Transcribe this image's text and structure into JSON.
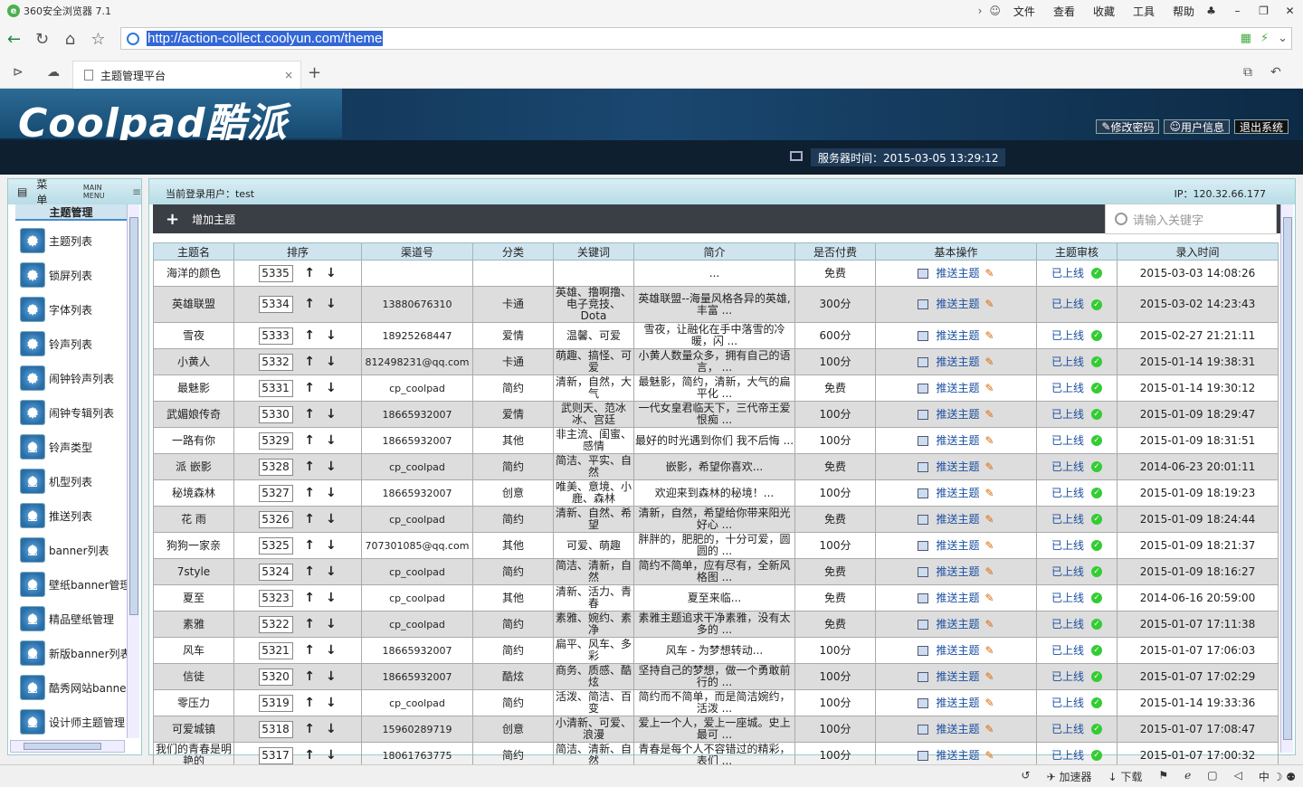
{
  "browser": {
    "title": "360安全浏览器 7.1",
    "menu": [
      "文件",
      "查看",
      "收藏",
      "工具",
      "帮助"
    ],
    "url": "http://action-collect.coolyun.com/theme",
    "tab_title": "主题管理平台"
  },
  "header": {
    "brand": "Coolpad酷派",
    "buttons": [
      "修改密码",
      "用户信息",
      "退出系统"
    ],
    "server_time": "服务器时间：2015-03-05 13:29:12"
  },
  "sidebar": {
    "title": "菜单",
    "subtitle": "MAIN MENU",
    "section": "主题管理",
    "items": [
      {
        "label": "主题列表"
      },
      {
        "label": "锁屏列表"
      },
      {
        "label": "字体列表"
      },
      {
        "label": "铃声列表"
      },
      {
        "label": "闹钟铃声列表"
      },
      {
        "label": "闹钟专辑列表"
      },
      {
        "label": "铃声类型"
      },
      {
        "label": "机型列表"
      },
      {
        "label": "推送列表"
      },
      {
        "label": "banner列表"
      },
      {
        "label": "壁纸banner管理"
      },
      {
        "label": "精品壁纸管理"
      },
      {
        "label": "新版banner列表"
      },
      {
        "label": "酷秀网站banner"
      },
      {
        "label": "设计师主题管理"
      }
    ]
  },
  "main": {
    "current_user": "当前登录用户：test",
    "ip": "IP：120.32.66.177",
    "add_label": "增加主题",
    "search_placeholder": "请输入关键字",
    "columns": [
      "主题名",
      "排序",
      "渠道号",
      "分类",
      "关键词",
      "简介",
      "是否付费",
      "基本操作",
      "主题审核",
      "录入时间"
    ],
    "push_label": "推送主题",
    "rows": [
      {
        "name": "海洋的颜色",
        "order": "5335",
        "channel": "",
        "category": "",
        "keywords": "",
        "intro": "...",
        "paid": "免费",
        "status": "已上线",
        "time": "2015-03-03 14:08:26"
      },
      {
        "name": "英雄联盟",
        "order": "5334",
        "channel": "13880676310",
        "category": "卡通",
        "keywords": "英雄、撸啊撸、电子竞技、Dota",
        "intro": "英雄联盟--海量风格各异的英雄,丰富 ...",
        "paid": "300分",
        "status": "已上线",
        "time": "2015-03-02 14:23:43"
      },
      {
        "name": "雪夜",
        "order": "5333",
        "channel": "18925268447",
        "category": "爱情",
        "keywords": "温馨、可爱",
        "intro": "雪夜，让融化在手中落雪的冷暖，闪 ...",
        "paid": "600分",
        "status": "已上线",
        "time": "2015-02-27 21:21:11"
      },
      {
        "name": "小黄人",
        "order": "5332",
        "channel": "812498231@qq.com",
        "category": "卡通",
        "keywords": "萌趣、搞怪、可爱",
        "intro": "小黄人数量众多，拥有自己的语言， ...",
        "paid": "100分",
        "status": "已上线",
        "time": "2015-01-14 19:38:31"
      },
      {
        "name": "最魅影",
        "order": "5331",
        "channel": "cp_coolpad",
        "category": "简约",
        "keywords": "清新，自然，大气",
        "intro": "最魅影，简约，清新，大气的扁平化 ...",
        "paid": "免费",
        "status": "已上线",
        "time": "2015-01-14 19:30:12"
      },
      {
        "name": "武媚娘传奇",
        "order": "5330",
        "channel": "18665932007",
        "category": "爱情",
        "keywords": "武则天、范冰冰、宫廷",
        "intro": "一代女皇君临天下，三代帝王爱恨痴 ...",
        "paid": "100分",
        "status": "已上线",
        "time": "2015-01-09 18:29:47"
      },
      {
        "name": "一路有你",
        "order": "5329",
        "channel": "18665932007",
        "category": "其他",
        "keywords": "非主流、闺蜜、感情",
        "intro": "最好的时光遇到你们 我不后悔 ...",
        "paid": "100分",
        "status": "已上线",
        "time": "2015-01-09 18:31:51"
      },
      {
        "name": "派 嵌影",
        "order": "5328",
        "channel": "cp_coolpad",
        "category": "简约",
        "keywords": "简洁、平实、自然",
        "intro": "嵌影，希望你喜欢...",
        "paid": "免费",
        "status": "已上线",
        "time": "2014-06-23 20:01:11"
      },
      {
        "name": "秘境森林",
        "order": "5327",
        "channel": "18665932007",
        "category": "创意",
        "keywords": "唯美、意境、小鹿、森林",
        "intro": "欢迎来到森林的秘境！...",
        "paid": "100分",
        "status": "已上线",
        "time": "2015-01-09 18:19:23"
      },
      {
        "name": "花 雨",
        "order": "5326",
        "channel": "cp_coolpad",
        "category": "简约",
        "keywords": "清新、自然、希望",
        "intro": "清新，自然，希望给你带来阳光好心 ...",
        "paid": "免费",
        "status": "已上线",
        "time": "2015-01-09 18:24:44"
      },
      {
        "name": "狗狗一家亲",
        "order": "5325",
        "channel": "707301085@qq.com",
        "category": "其他",
        "keywords": "可爱、萌趣",
        "intro": "胖胖的，肥肥的，十分可爱，圆圆的 ...",
        "paid": "100分",
        "status": "已上线",
        "time": "2015-01-09 18:21:37"
      },
      {
        "name": "7style",
        "order": "5324",
        "channel": "cp_coolpad",
        "category": "简约",
        "keywords": "简洁、清新，自然",
        "intro": "简约不简单，应有尽有，全新风格图 ...",
        "paid": "免费",
        "status": "已上线",
        "time": "2015-01-09 18:16:27"
      },
      {
        "name": "夏至",
        "order": "5323",
        "channel": "cp_coolpad",
        "category": "其他",
        "keywords": "清新、活力、青春",
        "intro": "夏至来临...",
        "paid": "免费",
        "status": "已上线",
        "time": "2014-06-16 20:59:00"
      },
      {
        "name": "素雅",
        "order": "5322",
        "channel": "cp_coolpad",
        "category": "简约",
        "keywords": "素雅、婉约、素净",
        "intro": "素雅主题追求干净素雅，没有太多的 ...",
        "paid": "免费",
        "status": "已上线",
        "time": "2015-01-07 17:11:38"
      },
      {
        "name": "风车",
        "order": "5321",
        "channel": "18665932007",
        "category": "简约",
        "keywords": "扁平、风车、多彩",
        "intro": "风车 - 为梦想转动...",
        "paid": "100分",
        "status": "已上线",
        "time": "2015-01-07 17:06:03"
      },
      {
        "name": "信徒",
        "order": "5320",
        "channel": "18665932007",
        "category": "酷炫",
        "keywords": "商务、质感、酷炫",
        "intro": "坚持自己的梦想，做一个勇敢前行的 ...",
        "paid": "100分",
        "status": "已上线",
        "time": "2015-01-07 17:02:29"
      },
      {
        "name": "零压力",
        "order": "5319",
        "channel": "cp_coolpad",
        "category": "简约",
        "keywords": "活泼、简洁、百变",
        "intro": "简约而不简单，而是简洁婉约，活泼 ...",
        "paid": "100分",
        "status": "已上线",
        "time": "2015-01-14 19:33:36"
      },
      {
        "name": "可爱城镇",
        "order": "5318",
        "channel": "15960289719",
        "category": "创意",
        "keywords": "小清新、可爱、浪漫",
        "intro": "爱上一个人，爱上一座城。史上最可 ...",
        "paid": "100分",
        "status": "已上线",
        "time": "2015-01-07 17:08:47"
      },
      {
        "name": "我们的青春是明艳的",
        "order": "5317",
        "channel": "18061763775",
        "category": "简约",
        "keywords": "简洁、清新、自然",
        "intro": "青春是每个人不容错过的精彩，表们 ...",
        "paid": "100分",
        "status": "已上线",
        "time": "2015-01-07 17:00:32"
      }
    ]
  },
  "statusbar": [
    "加速器",
    "下载",
    "中"
  ]
}
